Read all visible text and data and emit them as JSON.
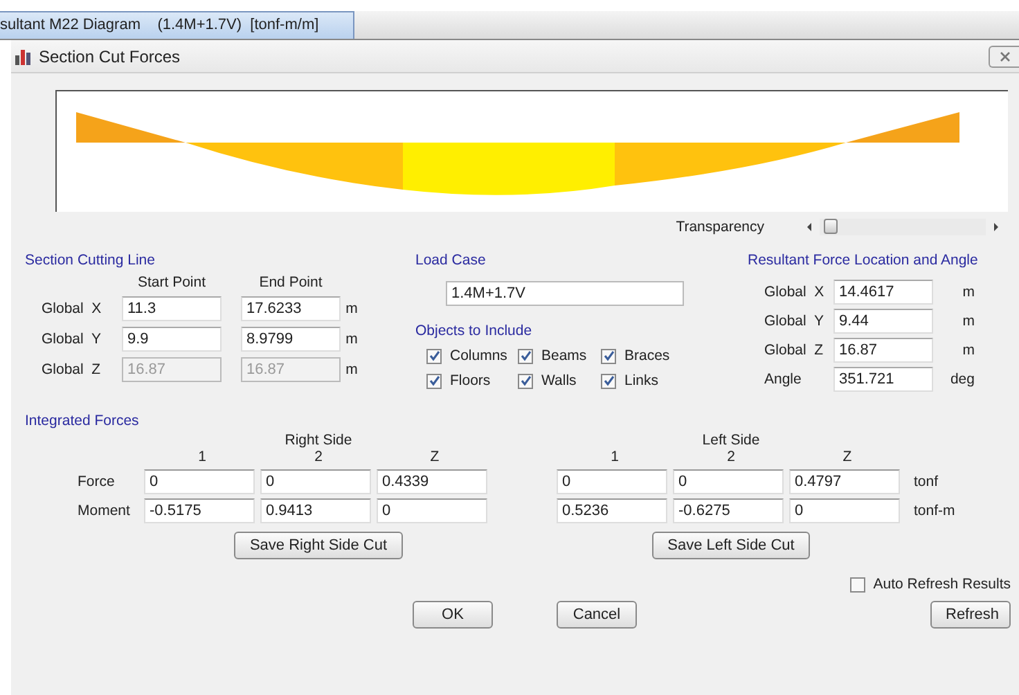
{
  "tab": {
    "title": "sultant M22 Diagram    (1.4M+1.7V)  [tonf-m/m]"
  },
  "dialog": {
    "title": "Section Cut Forces"
  },
  "transparency": {
    "label": "Transparency",
    "level": 0.03
  },
  "cutting_line": {
    "title": "Section Cutting Line",
    "headers": [
      "Start Point",
      "End Point"
    ],
    "rows": [
      {
        "label": "Global  X",
        "start": "11.3",
        "end": "17.6233",
        "unit": "m",
        "disabled": false
      },
      {
        "label": "Global  Y",
        "start": "9.9",
        "end": "8.9799",
        "unit": "m",
        "disabled": false
      },
      {
        "label": "Global  Z",
        "start": "16.87",
        "end": "16.87",
        "unit": "m",
        "disabled": true
      }
    ]
  },
  "load_case": {
    "title": "Load Case",
    "value": "1.4M+1.7V"
  },
  "objects": {
    "title": "Objects to Include",
    "items": [
      {
        "label": "Columns",
        "checked": true
      },
      {
        "label": "Beams",
        "checked": true
      },
      {
        "label": "Braces",
        "checked": true
      },
      {
        "label": "Floors",
        "checked": true
      },
      {
        "label": "Walls",
        "checked": true
      },
      {
        "label": "Links",
        "checked": true
      }
    ]
  },
  "resultant": {
    "title": "Resultant Force Location and Angle",
    "rows": [
      {
        "label": "Global  X",
        "value": "14.4617",
        "unit": "m"
      },
      {
        "label": "Global  Y",
        "value": "9.44",
        "unit": "m"
      },
      {
        "label": "Global  Z",
        "value": "16.87",
        "unit": "m"
      },
      {
        "label": "Angle",
        "value": "351.721",
        "unit": "deg"
      }
    ]
  },
  "integrated": {
    "title": "Integrated Forces",
    "row_labels": [
      "Force",
      "Moment"
    ],
    "units": [
      "tonf",
      "tonf-m"
    ],
    "sides": [
      {
        "title": "Right Side",
        "columns": [
          "1",
          "2",
          "Z"
        ],
        "rows": [
          [
            "0",
            "0",
            "0.4339"
          ],
          [
            "-0.5175",
            "0.9413",
            "0"
          ]
        ],
        "button": "Save Right Side Cut"
      },
      {
        "title": "Left Side",
        "columns": [
          "1",
          "2",
          "Z"
        ],
        "rows": [
          [
            "0",
            "0",
            "0.4797"
          ],
          [
            "0.5236",
            "-0.6275",
            "0"
          ]
        ],
        "button": "Save Left Side Cut"
      }
    ]
  },
  "auto_refresh": {
    "label": "Auto Refresh Results",
    "checked": false
  },
  "buttons": {
    "ok": "OK",
    "cancel": "Cancel",
    "refresh": "Refresh"
  }
}
